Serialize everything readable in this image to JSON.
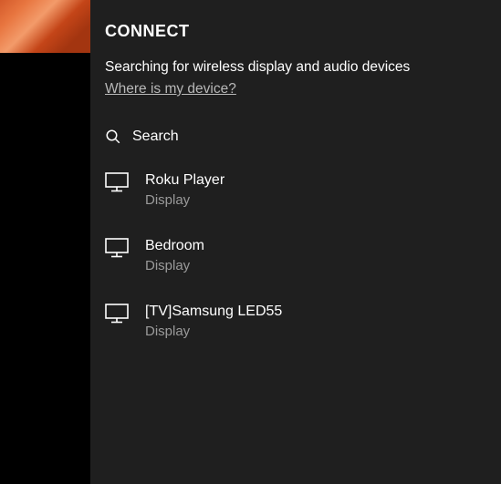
{
  "panel": {
    "title": "CONNECT",
    "status": "Searching for wireless display and audio devices",
    "help_link": "Where is my device?",
    "search_label": "Search"
  },
  "devices": [
    {
      "name": "Roku Player",
      "type": "Display",
      "icon": "monitor"
    },
    {
      "name": "Bedroom",
      "type": "Display",
      "icon": "monitor"
    },
    {
      "name": "[TV]Samsung LED55",
      "type": "Display",
      "icon": "monitor"
    }
  ]
}
